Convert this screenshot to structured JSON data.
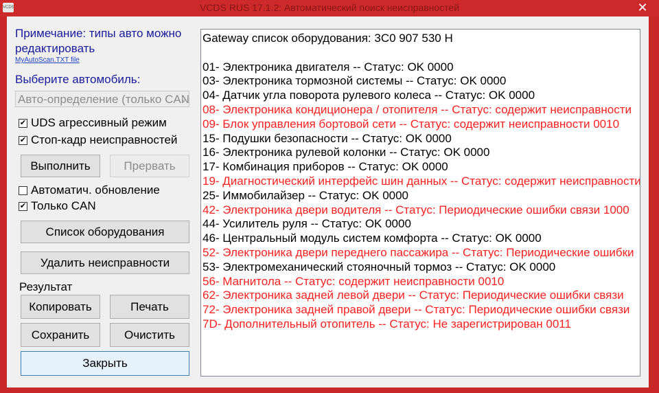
{
  "window": {
    "icon_text": "VCDS",
    "title": "VCDS RUS 17.1.2: Автоматический поиск неисправностей",
    "close_glyph": "✕"
  },
  "left": {
    "note": "Примечание: типы авто можно редактировать",
    "note_link": "MyAutoScan.TXT file",
    "select_label": "Выберите автомобиль:",
    "select_value": "Авто-определение (только CAN)",
    "select_arrow": "∨",
    "check_uds": {
      "label": "UDS агрессивный режим",
      "checked": "✔"
    },
    "check_freeze": {
      "label": "Стоп-кадр неисправностей",
      "checked": "✔"
    },
    "run_label": "Выполнить",
    "abort_label": "Прервать",
    "check_auto": {
      "label": "Автоматич. обновление",
      "checked": ""
    },
    "check_can": {
      "label": "Только CAN",
      "checked": "✔"
    },
    "equipment_label": "Список оборудования",
    "clear_faults_label": "Удалить неисправности",
    "result_label": "Результат",
    "copy_label": "Копировать",
    "print_label": "Печать",
    "save_label": "Сохранить",
    "clear_label": "Очистить",
    "close_label": "Закрыть"
  },
  "colors": {
    "ok": "#000000",
    "fault": "#ff2020"
  },
  "output_lines": [
    {
      "text": "Gateway список оборудования:  3C0 907 530 H",
      "status": "ok"
    },
    {
      "text": "",
      "status": "ok"
    },
    {
      "text": "01- Электроника двигателя -- Статус: OK 0000",
      "status": "ok"
    },
    {
      "text": "03- Электроника тормозной системы -- Статус: OK 0000",
      "status": "ok"
    },
    {
      "text": "04- Датчик угла поворота рулевого колеса -- Статус: OK 0000",
      "status": "ok"
    },
    {
      "text": "08- Электроника кондиционера / отопителя -- Статус: содержит неисправности",
      "status": "fault"
    },
    {
      "text": "09- Блок управления бортовой сети -- Статус: содержит неисправности 0010",
      "status": "fault"
    },
    {
      "text": "15- Подушки безопасности -- Статус: OK 0000",
      "status": "ok"
    },
    {
      "text": "16- Электроника рулевой колонки -- Статус: OK 0000",
      "status": "ok"
    },
    {
      "text": "17- Комбинация приборов -- Статус: OK 0000",
      "status": "ok"
    },
    {
      "text": "19- Диагностический интерфейс шин данных -- Статус: содержит неисправности",
      "status": "fault"
    },
    {
      "text": "25- Иммобилайзер -- Статус: OK 0000",
      "status": "ok"
    },
    {
      "text": "42- Электроника двери водителя -- Статус: Периодические ошибки связи 1000",
      "status": "fault"
    },
    {
      "text": "44- Усилитель руля -- Статус: OK 0000",
      "status": "ok"
    },
    {
      "text": "46- Центральный модуль систем комфорта -- Статус: OK 0000",
      "status": "ok"
    },
    {
      "text": "52- Электроника двери переднего пассажира -- Статус: Периодические ошибки",
      "status": "fault"
    },
    {
      "text": "53- Электромеханический стояночный тормоз -- Статус: OK 0000",
      "status": "ok"
    },
    {
      "text": "56- Магнитола -- Статус: содержит неисправности 0010",
      "status": "fault"
    },
    {
      "text": "62- Электроника задней левой двери -- Статус: Периодические ошибки связи",
      "status": "fault"
    },
    {
      "text": "72- Электроника задней правой двери -- Статус: Периодические ошибки связи",
      "status": "fault"
    },
    {
      "text": "7D- Дополнительный отопитель -- Статус: Не зарегистрирован 0011",
      "status": "fault"
    }
  ]
}
